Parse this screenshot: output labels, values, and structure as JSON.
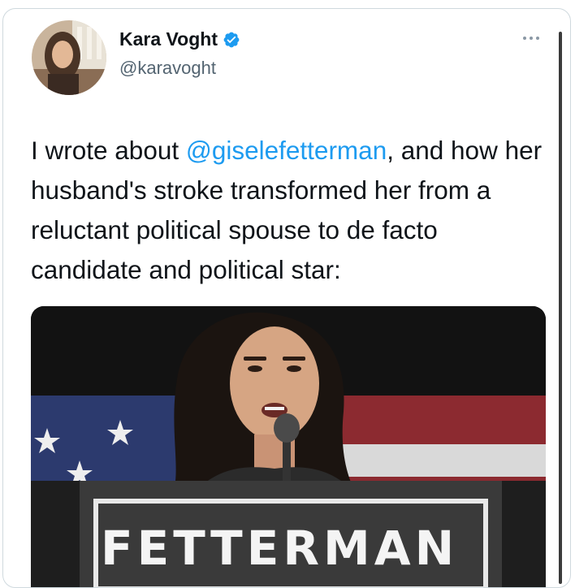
{
  "tweet": {
    "author": {
      "display_name": "Kara Voght",
      "handle": "@karavoght",
      "verified": true,
      "avatar_icon": "avatar-photo"
    },
    "more_icon": "more-options-icon",
    "text_parts": {
      "before_mention": "I wrote about ",
      "mention": "@giselefetterman",
      "after_mention": ", and how her husband's stroke transformed her from a reluctant political spouse to de facto candidate and political star:"
    },
    "media": {
      "podium_text": "FETTERMAN"
    }
  },
  "colors": {
    "link": "#1d9bf0",
    "text": "#0f1419",
    "secondary": "#536471",
    "verified": "#1d9bf0",
    "border": "#cfd9de"
  }
}
